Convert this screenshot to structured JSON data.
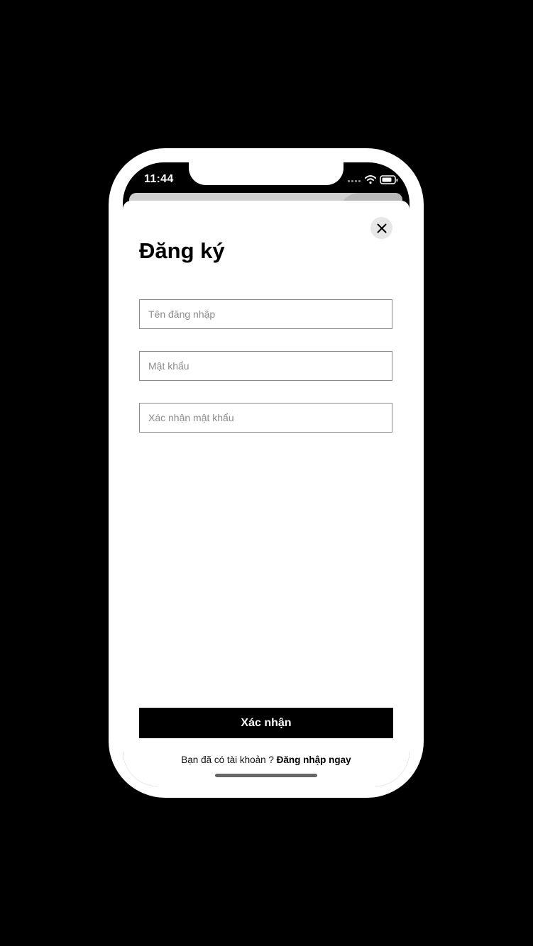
{
  "status_bar": {
    "time": "11:44",
    "icons": [
      "signal-icon",
      "wifi-icon",
      "battery-icon"
    ]
  },
  "sheet": {
    "title": "Đăng ký",
    "close_icon": "close-icon"
  },
  "form": {
    "username": {
      "placeholder": "Tên đăng nhập",
      "value": ""
    },
    "password": {
      "placeholder": "Mật khẩu",
      "value": ""
    },
    "confirm_password": {
      "placeholder": "Xác nhận mật khẩu",
      "value": ""
    }
  },
  "actions": {
    "submit_label": "Xác nhận"
  },
  "footer": {
    "prompt": "Bạn đã có tài khoản ?",
    "login_link": "Đăng nhập ngay"
  },
  "colors": {
    "background": "#000000",
    "sheet": "#ffffff",
    "primary_button": "#000000",
    "input_border": "#8a8a8a"
  }
}
